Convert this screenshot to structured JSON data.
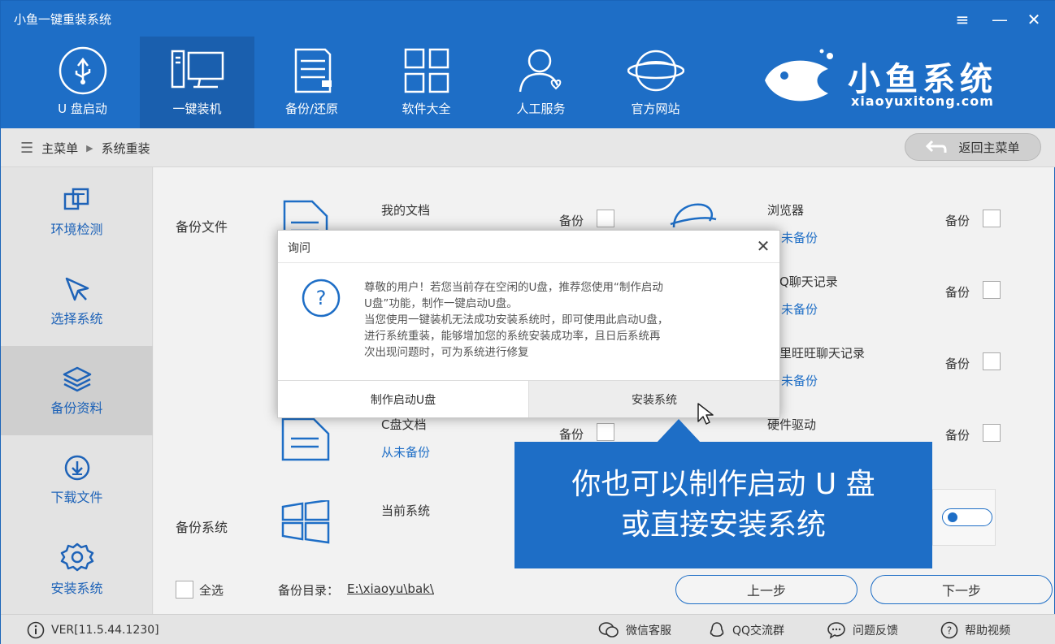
{
  "app": {
    "title": "小鱼一键重装系统",
    "menu_icon": "≡",
    "minimize_icon": "—",
    "close_icon": "✕"
  },
  "nav": [
    {
      "label": "U 盘启动",
      "icon": "usb-icon"
    },
    {
      "label": "一键装机",
      "icon": "monitor-icon",
      "active": true
    },
    {
      "label": "备份/还原",
      "icon": "document-icon"
    },
    {
      "label": "软件大全",
      "icon": "grid-icon"
    },
    {
      "label": "人工服务",
      "icon": "person-icon"
    },
    {
      "label": "官方网站",
      "icon": "globe-icon"
    }
  ],
  "brand": {
    "name": "小鱼系统",
    "url": "xiaoyuxitong.com"
  },
  "breadcrumb": {
    "root": "主菜单",
    "separator": "▶",
    "current": "系统重装"
  },
  "back_button": "返回主菜单",
  "sidebar": [
    {
      "label": "环境检测",
      "icon": "env-check-icon"
    },
    {
      "label": "选择系统",
      "icon": "cursor-icon"
    },
    {
      "label": "备份资料",
      "icon": "layers-icon",
      "active": true
    },
    {
      "label": "下载文件",
      "icon": "download-icon"
    },
    {
      "label": "安装系统",
      "icon": "gear-icon"
    }
  ],
  "main": {
    "backup_files_label": "备份文件",
    "backup_system_label": "备份系统",
    "backup_word": "备份",
    "rows_left": [
      {
        "title": "我的文档",
        "status": ""
      },
      {
        "title": "C盘文档",
        "status": "从未备份"
      },
      {
        "title": "当前系统",
        "status": ""
      }
    ],
    "rows_right": [
      {
        "title": "浏览器",
        "status": "未备份"
      },
      {
        "title": "Q聊天记录",
        "status": "未备份"
      },
      {
        "title": "里旺旺聊天记录",
        "status": "未备份"
      },
      {
        "title": "硬件驱动",
        "status": ""
      }
    ],
    "select_all": "全选",
    "backup_dir_label": "备份目录：",
    "backup_dir_value": "E:\\xiaoyu\\bak\\",
    "prev_button": "上一步",
    "next_button": "下一步"
  },
  "status": {
    "version": "VER[11.5.44.1230]",
    "links": [
      "微信客服",
      "QQ交流群",
      "问题反馈",
      "帮助视频"
    ]
  },
  "dialog": {
    "title": "询问",
    "lines": [
      "尊敬的用户！若您当前存在空闲的U盘，推荐您使用“制作启动",
      "U盘”功能，制作一键启动U盘。",
      "当您使用一键装机无法成功安装系统时，即可使用此启动U盘，",
      "进行系统重装，能够增加您的系统安装成功率，且日后系统再",
      "次出现问题时，可为系统进行修复"
    ],
    "btn_make": "制作启动U盘",
    "btn_install": "安装系统"
  },
  "callout": {
    "line1": "你也可以制作启动 U 盘",
    "line2": "或直接安装系统"
  },
  "colors": {
    "brand_blue": "#1e6ec6",
    "status_blue": "#1e6ec6"
  }
}
